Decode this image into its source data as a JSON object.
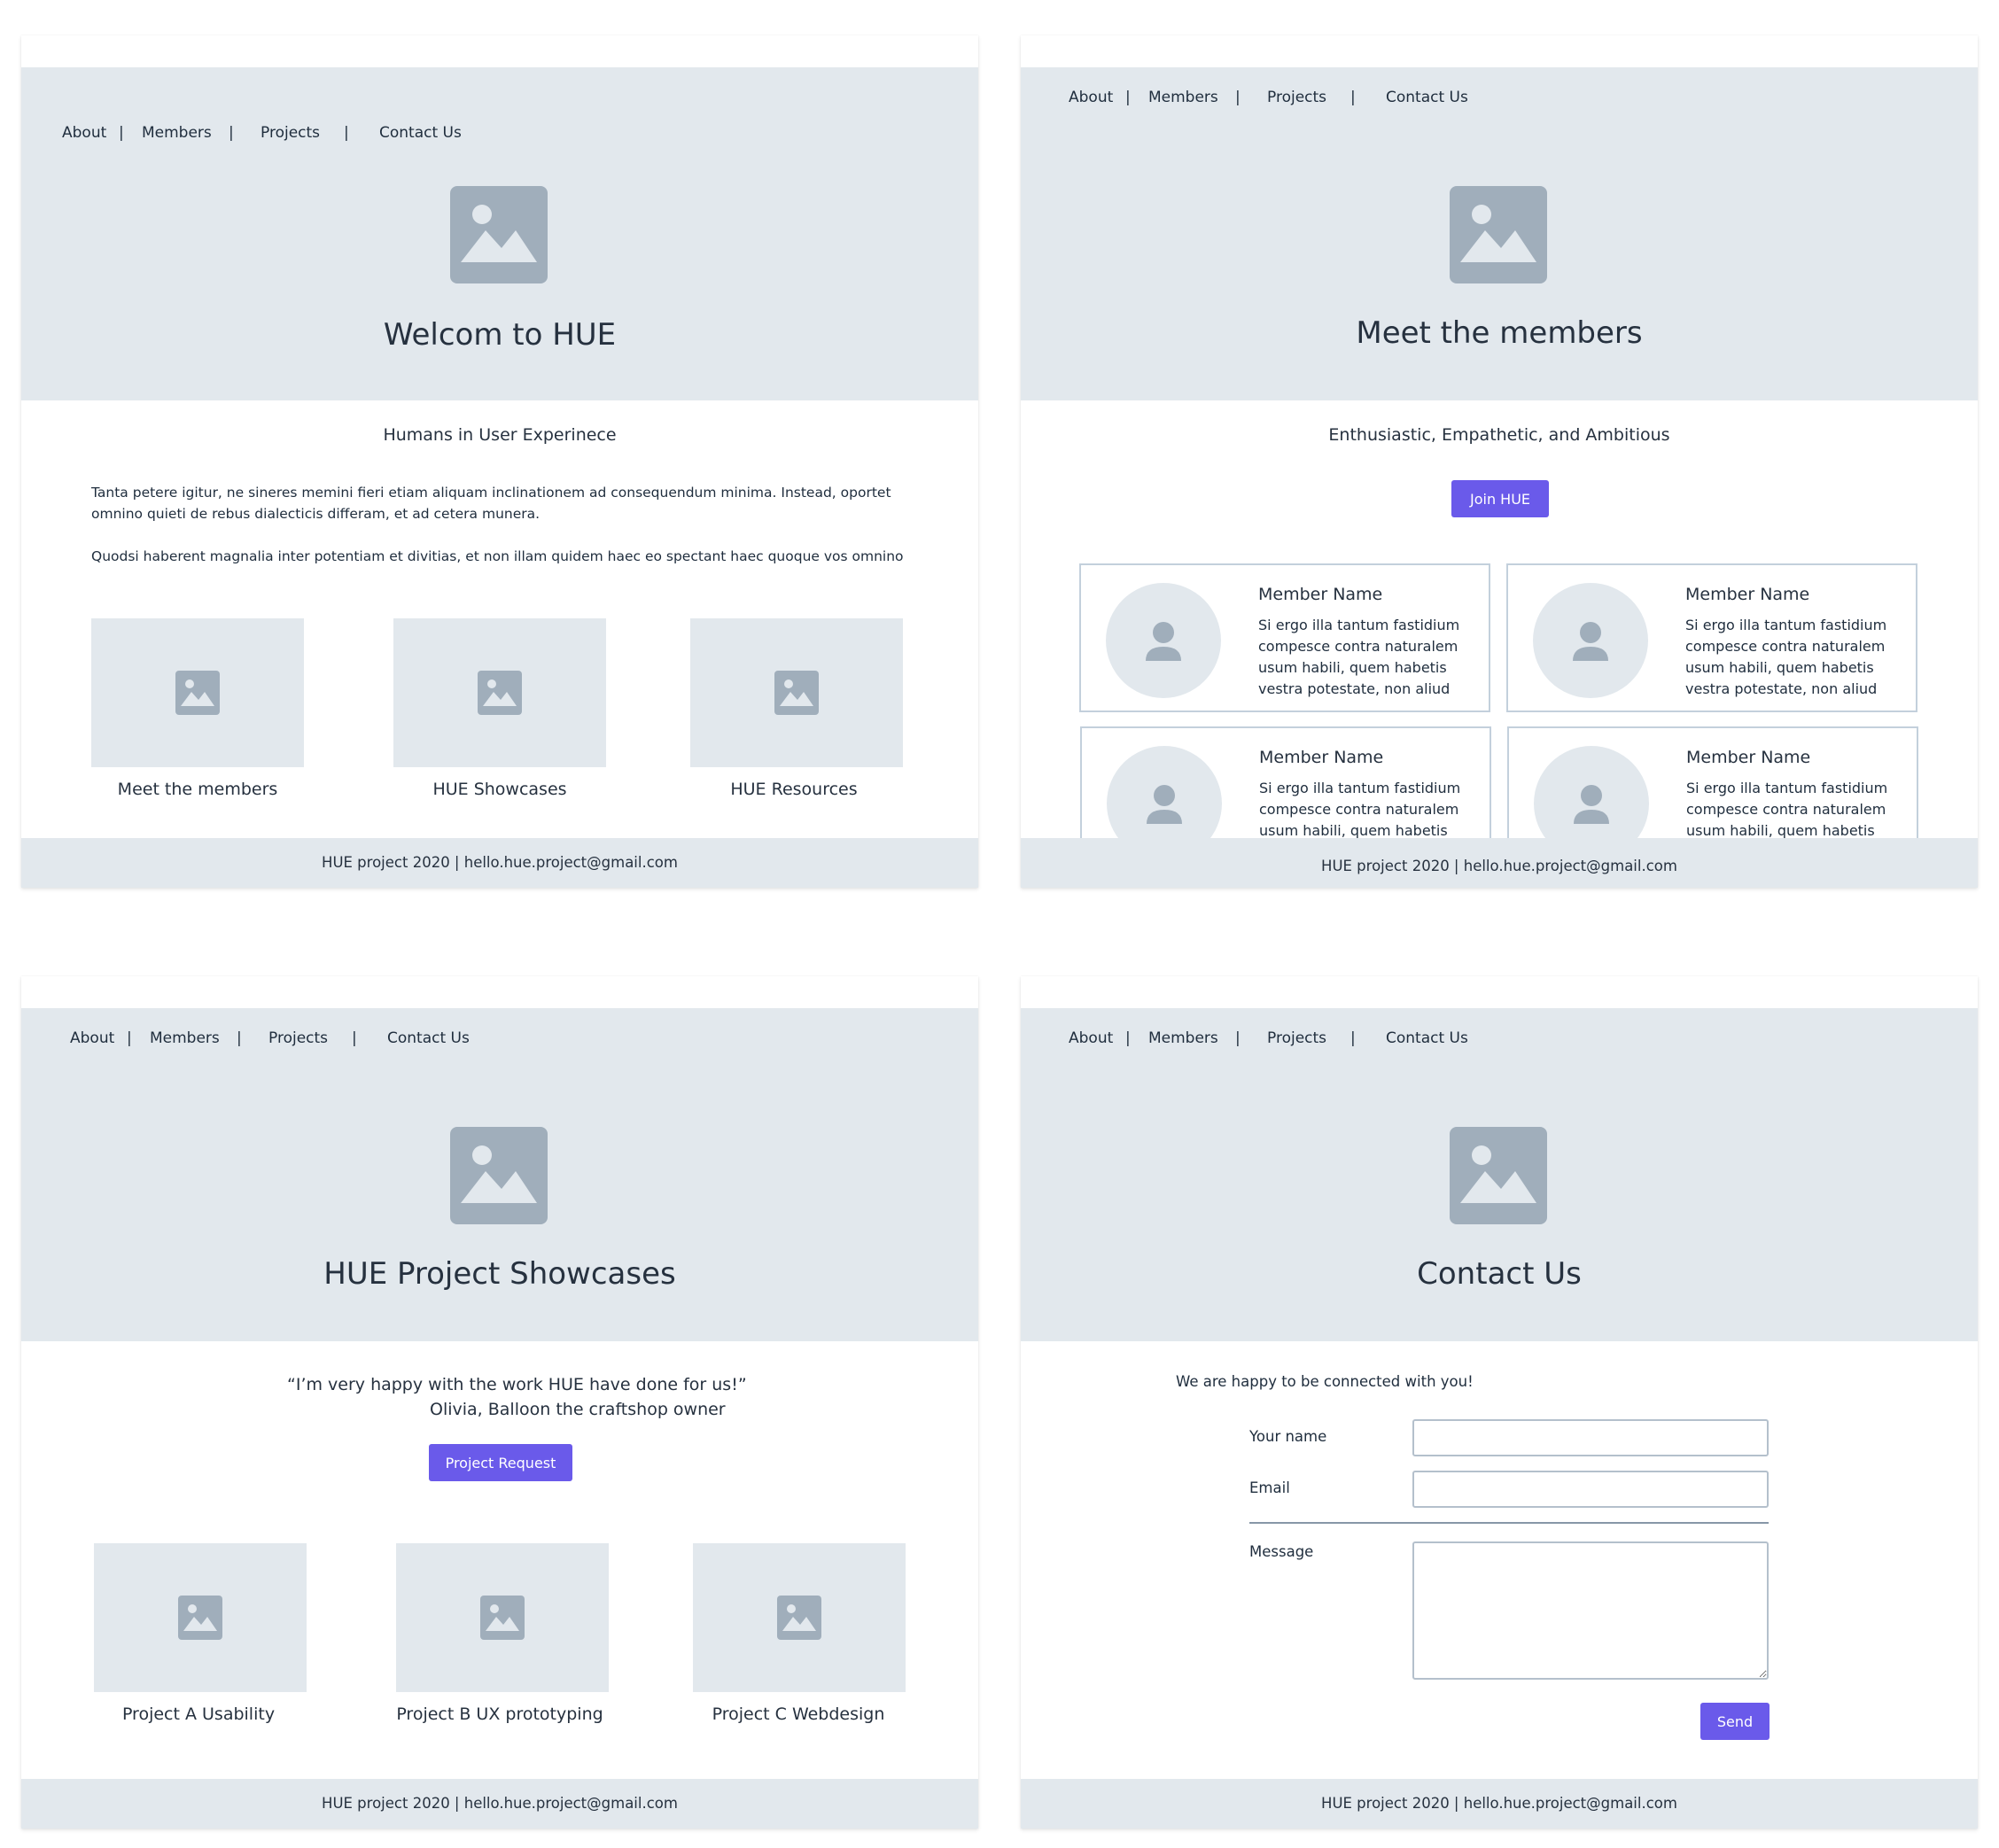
{
  "nav": [
    "About",
    "Members",
    "Projects",
    "Contact Us"
  ],
  "nav_separator": "|",
  "footer": "HUE project 2020 | hello.hue.project@gmail.com",
  "colors": {
    "hero_bg": "#e2e8ed",
    "placeholder": "#a0aebb",
    "accent": "#6a5aea",
    "card_border": "#c3d0dc",
    "text": "#26313f"
  },
  "home": {
    "title": "Welcom to HUE",
    "subtitle": "Humans in User Experinece",
    "para1": "Tanta petere igitur, ne sineres memini fieri etiam aliquam inclinationem ad consequendum minima. Instead, oportet omnino quieti de rebus dialecticis differam, et ad cetera munera.",
    "para2": "Quodsi haberent magnalia inter potentiam et divitias, et non illam quidem haec eo spectant haec quoque vos omnino",
    "cards": [
      "Meet the members",
      "HUE Showcases",
      "HUE Resources"
    ]
  },
  "members": {
    "title": "Meet the members",
    "subtitle": "Enthusiastic, Empathetic, and Ambitious",
    "join_label": "Join HUE",
    "cards": [
      {
        "name": "Member Name",
        "text": "Si ergo illa tantum fastidium compesce contra naturalem usum habili, quem habetis vestra potestate, non aliud"
      },
      {
        "name": "Member Name",
        "text": "Si ergo illa tantum fastidium compesce contra naturalem usum habili, quem habetis vestra potestate, non aliud"
      },
      {
        "name": "Member Name",
        "text": "Si ergo illa tantum fastidium compesce contra naturalem usum habili, quem habetis vestra potestate, non aliud"
      },
      {
        "name": "Member Name",
        "text": "Si ergo illa tantum fastidium compesce contra naturalem usum habili, quem habetis vestra potestate, non aliud"
      }
    ]
  },
  "showcases": {
    "title": "HUE Project Showcases",
    "quote": "“I’m very happy with the work HUE have done for us!”",
    "quote_author": "Olivia, Balloon the craftshop owner",
    "request_label": "Project Request",
    "projects": [
      "Project A Usability",
      "Project B  UX prototyping",
      "Project C Webdesign"
    ]
  },
  "contact": {
    "title": "Contact Us",
    "intro": "We are happy to be connected with  you!",
    "name_label": "Your name",
    "email_label": "Email",
    "message_label": "Message",
    "name_value": "",
    "email_value": "",
    "message_value": "",
    "send_label": "Send"
  }
}
